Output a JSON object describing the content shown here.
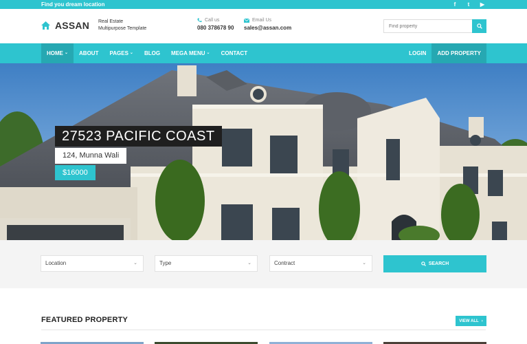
{
  "topbar": {
    "tagline": "Find you dream location",
    "social": [
      {
        "icon": "facebook-icon",
        "glyph": "f"
      },
      {
        "icon": "twitter-icon",
        "glyph": "t"
      },
      {
        "icon": "youtube-icon",
        "glyph": "▶"
      }
    ]
  },
  "header": {
    "brand": "ASSAN",
    "subtitle_line1": "Real Estate",
    "subtitle_line2": "Multipurpose Template",
    "phone_label": "Call us",
    "phone": "080 378678 90",
    "email_label": "Email Us",
    "email": "sales@assan.com",
    "search_placeholder": "Find property"
  },
  "nav": {
    "items": [
      {
        "label": "HOME",
        "caret": "⌄"
      },
      {
        "label": "ABOUT"
      },
      {
        "label": "PAGES",
        "caret": "⌄"
      },
      {
        "label": "BLOG"
      },
      {
        "label": "MEGA MENU",
        "caret": "⌄"
      },
      {
        "label": "CONTACT"
      }
    ],
    "login": "LOGIN",
    "add_property": "ADD PROPERTY"
  },
  "hero": {
    "title": "27523 PACIFIC COAST",
    "address": "124, Munna Wali",
    "price": "$16000"
  },
  "filters": {
    "location": "Location",
    "type": "Type",
    "contract": "Contract",
    "search": "SEARCH"
  },
  "featured": {
    "title": "FEATURED PROPERTY",
    "view_all": "VIEW ALL"
  },
  "colors": {
    "accent": "#2ec4cf",
    "accent_dark": "#26a8b2"
  }
}
